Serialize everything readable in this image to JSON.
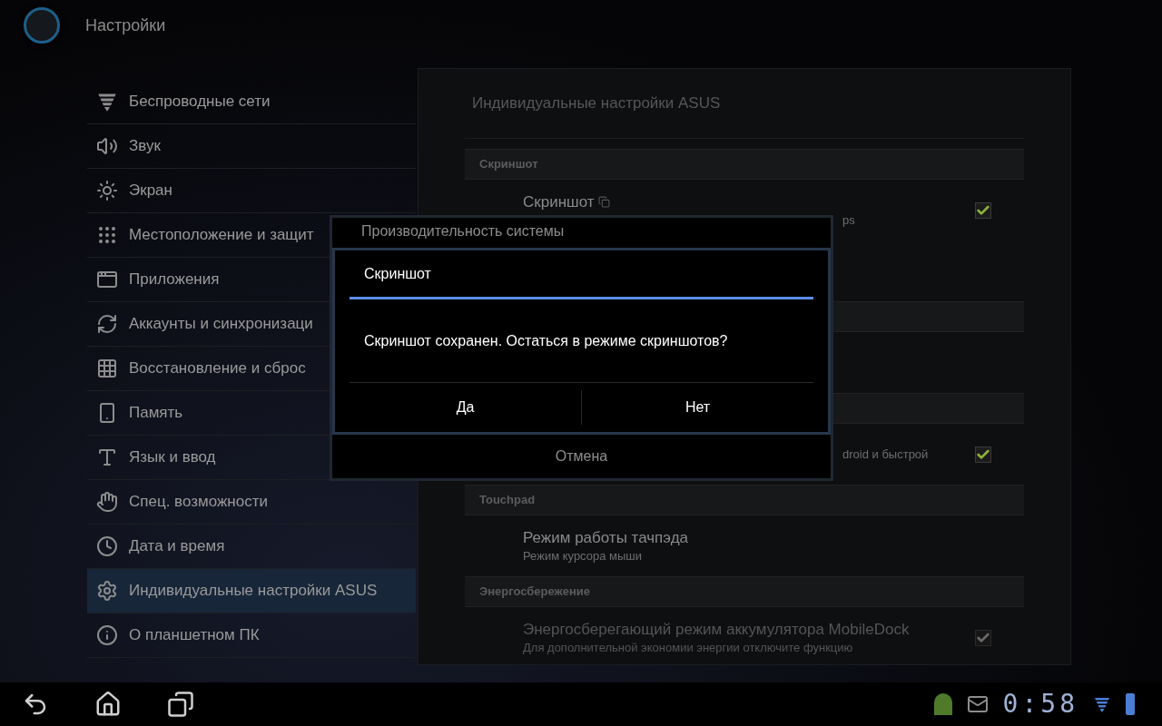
{
  "action_bar": {
    "title": "Настройки"
  },
  "sidebar": {
    "items": [
      {
        "label": "Беспроводные сети",
        "selected": false
      },
      {
        "label": "Звук",
        "selected": false
      },
      {
        "label": "Экран",
        "selected": false
      },
      {
        "label": "Местоположение и защит",
        "selected": false
      },
      {
        "label": "Приложения",
        "selected": false
      },
      {
        "label": "Аккаунты и синхронизаци",
        "selected": false
      },
      {
        "label": "Восстановление и сброс",
        "selected": false
      },
      {
        "label": "Память",
        "selected": false
      },
      {
        "label": "Язык и ввод",
        "selected": false
      },
      {
        "label": "Спец. возможности",
        "selected": false
      },
      {
        "label": "Дата и время",
        "selected": false
      },
      {
        "label": "Индивидуальные настройки ASUS",
        "selected": true
      },
      {
        "label": "О планшетном ПК",
        "selected": false
      }
    ]
  },
  "panel": {
    "title": "Индивидуальные настройки ASUS",
    "items": [
      {
        "kind": "header",
        "title": "Скриншот"
      },
      {
        "kind": "row",
        "title": "Скриншот",
        "summary": "ps",
        "covered": true,
        "checkbox": {
          "checked": true,
          "disabled": false
        }
      },
      {
        "kind": "row"
      },
      {
        "kind": "header"
      },
      {
        "kind": "row"
      },
      {
        "kind": "header"
      },
      {
        "kind": "row",
        "summary": "droid и быстрой",
        "covered": true,
        "checkbox": {
          "checked": true,
          "disabled": false
        }
      },
      {
        "kind": "header",
        "title": "Touchpad"
      },
      {
        "kind": "row",
        "title": "Режим работы тачпэда",
        "summary": "Режим курсора мыши"
      },
      {
        "kind": "header",
        "title": "Энергосбережение"
      },
      {
        "kind": "row",
        "title": "Энергосберегающий режим аккумулятора MobileDock",
        "summary": "Для дополнительной экономии энергии отключите функцию",
        "disabled": true,
        "checkbox": {
          "checked": true,
          "disabled": true
        }
      }
    ]
  },
  "back_dialog": {
    "title": "Производительность системы",
    "button": "Отмена"
  },
  "dialog": {
    "title": "Скриншот",
    "message": "Скриншот сохранен. Остаться в режиме скриншотов?",
    "buttons": [
      "Да",
      "Нет"
    ]
  },
  "status_bar": {
    "time": "0:58"
  }
}
